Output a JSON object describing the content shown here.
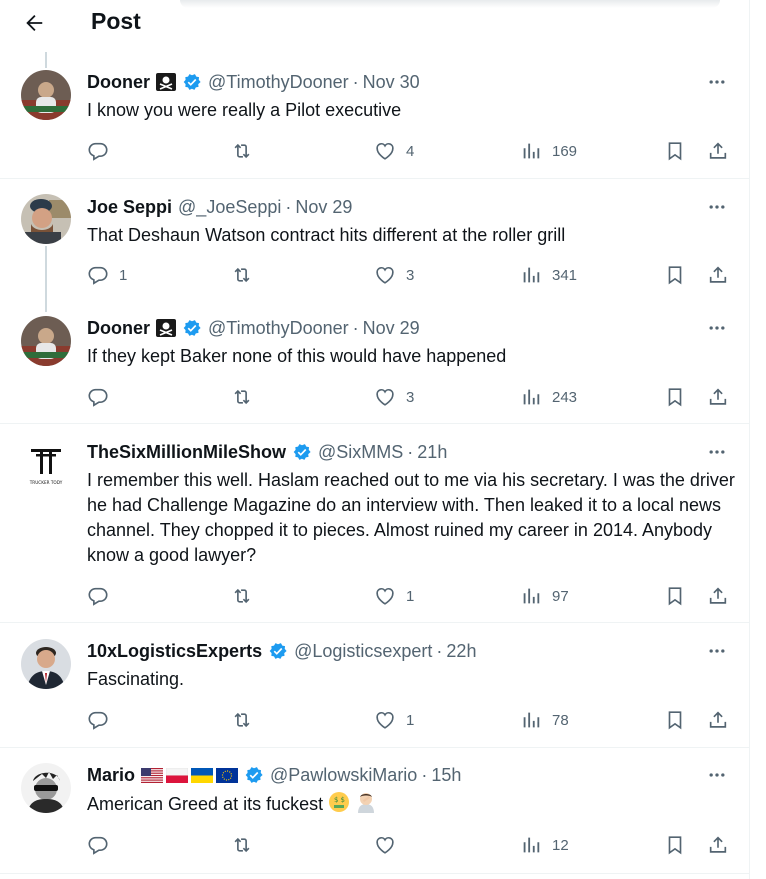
{
  "header": {
    "title": "Post"
  },
  "tweets": [
    {
      "name": "Dooner",
      "name_emoji": "pirate-flag",
      "verified": true,
      "flags": [],
      "handle": "@TimothyDooner",
      "time": "Nov 30",
      "text": "I know you were really a Pilot executive",
      "text_emojis": [],
      "reply_count": "",
      "retweet_count": "",
      "like_count": "4",
      "view_count": "169"
    },
    {
      "name": "Joe Seppi",
      "name_emoji": "",
      "verified": false,
      "flags": [],
      "handle": "@_JoeSeppi",
      "time": "Nov 29",
      "text": "That Deshaun Watson contract hits different at the roller grill",
      "text_emojis": [],
      "reply_count": "1",
      "retweet_count": "",
      "like_count": "3",
      "view_count": "341"
    },
    {
      "name": "Dooner",
      "name_emoji": "pirate-flag",
      "verified": true,
      "flags": [],
      "handle": "@TimothyDooner",
      "time": "Nov 29",
      "text": "If they kept Baker none of this would have happened",
      "text_emojis": [],
      "reply_count": "",
      "retweet_count": "",
      "like_count": "3",
      "view_count": "243"
    },
    {
      "name": "TheSixMillionMileShow",
      "name_emoji": "",
      "verified": true,
      "flags": [],
      "handle": "@SixMMS",
      "time": "21h",
      "text": "I remember this well. Haslam reached out to me via his secretary. I was the driver he had Challenge Magazine do an interview with. Then leaked it to a local news channel. They chopped it to pieces. Almost ruined my career in 2014. Anybody know a good lawyer?",
      "text_emojis": [],
      "reply_count": "",
      "retweet_count": "",
      "like_count": "1",
      "view_count": "97"
    },
    {
      "name": "10xLogisticsExperts",
      "name_emoji": "",
      "verified": true,
      "flags": [],
      "handle": "@Logisticsexpert",
      "time": "22h",
      "text": "Fascinating.",
      "text_emojis": [],
      "reply_count": "",
      "retweet_count": "",
      "like_count": "1",
      "view_count": "78"
    },
    {
      "name": "Mario",
      "name_emoji": "",
      "verified": true,
      "flags": [
        "us-flag",
        "poland-flag",
        "ukraine-flag",
        "eu-flag"
      ],
      "handle": "@PawlowskiMario",
      "time": "15h",
      "text": "American Greed at its fuckest",
      "text_emojis": [
        "money-mouth-face-emoji",
        "man-facepalming-emoji"
      ],
      "reply_count": "",
      "retweet_count": "",
      "like_count": "",
      "view_count": "12"
    }
  ],
  "avatar_tweet4": {
    "logo_text": "TRUCKER TODY"
  },
  "colors": {
    "verified": "#1d9bf0",
    "text": "#0f1419",
    "muted": "#536471",
    "border": "#eff3f4"
  },
  "icons": [
    "back-arrow-icon",
    "verified-badge-icon",
    "more-icon",
    "reply-icon",
    "retweet-icon",
    "like-icon",
    "views-icon",
    "bookmark-icon",
    "share-icon"
  ]
}
